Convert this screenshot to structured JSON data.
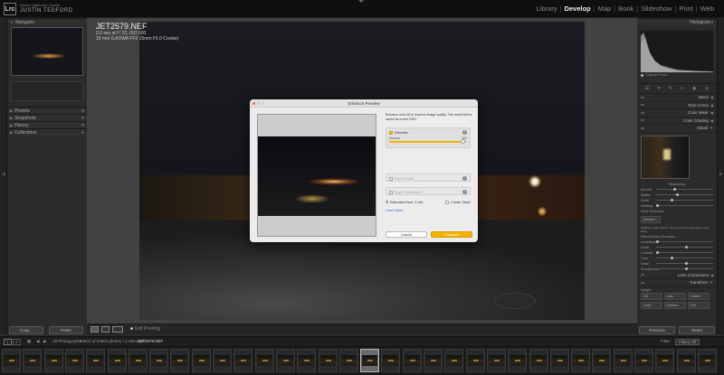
{
  "identity": {
    "logo": "Lrc",
    "app": "Adobe Lightroom Classic",
    "user": "JUSTIN TEDFORD"
  },
  "modules": [
    "Library",
    "Develop",
    "Map",
    "Book",
    "Slideshow",
    "Print",
    "Web"
  ],
  "active_module": "Develop",
  "left_panel": {
    "navigator": "Navigator",
    "sections": [
      "Presets",
      "Snapshots",
      "History",
      "Collections"
    ],
    "copy_button": "Copy...",
    "paste_button": "Paste"
  },
  "photo_info": {
    "filename": "JET2579.NEF",
    "exposure": "2.0 sec at f / 22, ISO 500",
    "lens": "15 mm (LAOWA FFII 15mm F5.0 Cookie)"
  },
  "dialog": {
    "title": "Enhance Preview",
    "description": "Enhance uses AI to improve image quality. The result will be saved as a new DNG.",
    "options": [
      {
        "label": "Denoise",
        "checked": true,
        "enabled": true
      },
      {
        "label": "Raw Details",
        "checked": false,
        "enabled": false
      },
      {
        "label": "Super Resolution",
        "checked": false,
        "enabled": false
      }
    ],
    "amount_label": "Amount",
    "amount_value": "100",
    "amount_fraction": 0.95,
    "estimated_time": "Estimated time: 2 min",
    "create_stack": "Create Stack",
    "learn_more": "Learn More",
    "cancel": "Cancel",
    "enhance": "Enhance"
  },
  "right_panel": {
    "histogram": "Histogram",
    "original_photo": "Original Photo",
    "sections": [
      "Basic",
      "Tone Curve",
      "Color Mixer",
      "Color Grading",
      "Detail"
    ],
    "sharpening": "Sharpening",
    "sharpen_sliders": [
      "Amount",
      "Radius",
      "Detail",
      "Masking"
    ],
    "noise_reduction": "Noise Reduction",
    "denoise_button": "Denoise...",
    "nr_note": "Enhance noise with AI. The result will be saved as a new DNG.",
    "manual_nr": "Manual Noise Reduction",
    "nr_sliders": [
      "Luminance",
      "Detail",
      "Contrast",
      "Color",
      "Detail",
      "Smoothness"
    ],
    "bottom_sections": [
      "Lens Corrections",
      "Transform"
    ],
    "transform_buttons": [
      "Off",
      "Auto",
      "Guided",
      "Level",
      "Vertical",
      "Full"
    ],
    "upright": "Upright",
    "previous_button": "Previous",
    "reset_button": "Reset"
  },
  "toolbar": {
    "soft_proofing": "Soft Proofing"
  },
  "filmbar": {
    "page1": "1",
    "page2": "2",
    "source": "All Photographs",
    "count": "84502 of 84502 photos / 1 selected /",
    "selected_file": "JET2579.NEF",
    "filter_label": "Filter:",
    "filter_value": "Filters Off"
  },
  "filmstrip": {
    "count": 34,
    "selected_index": 17
  }
}
